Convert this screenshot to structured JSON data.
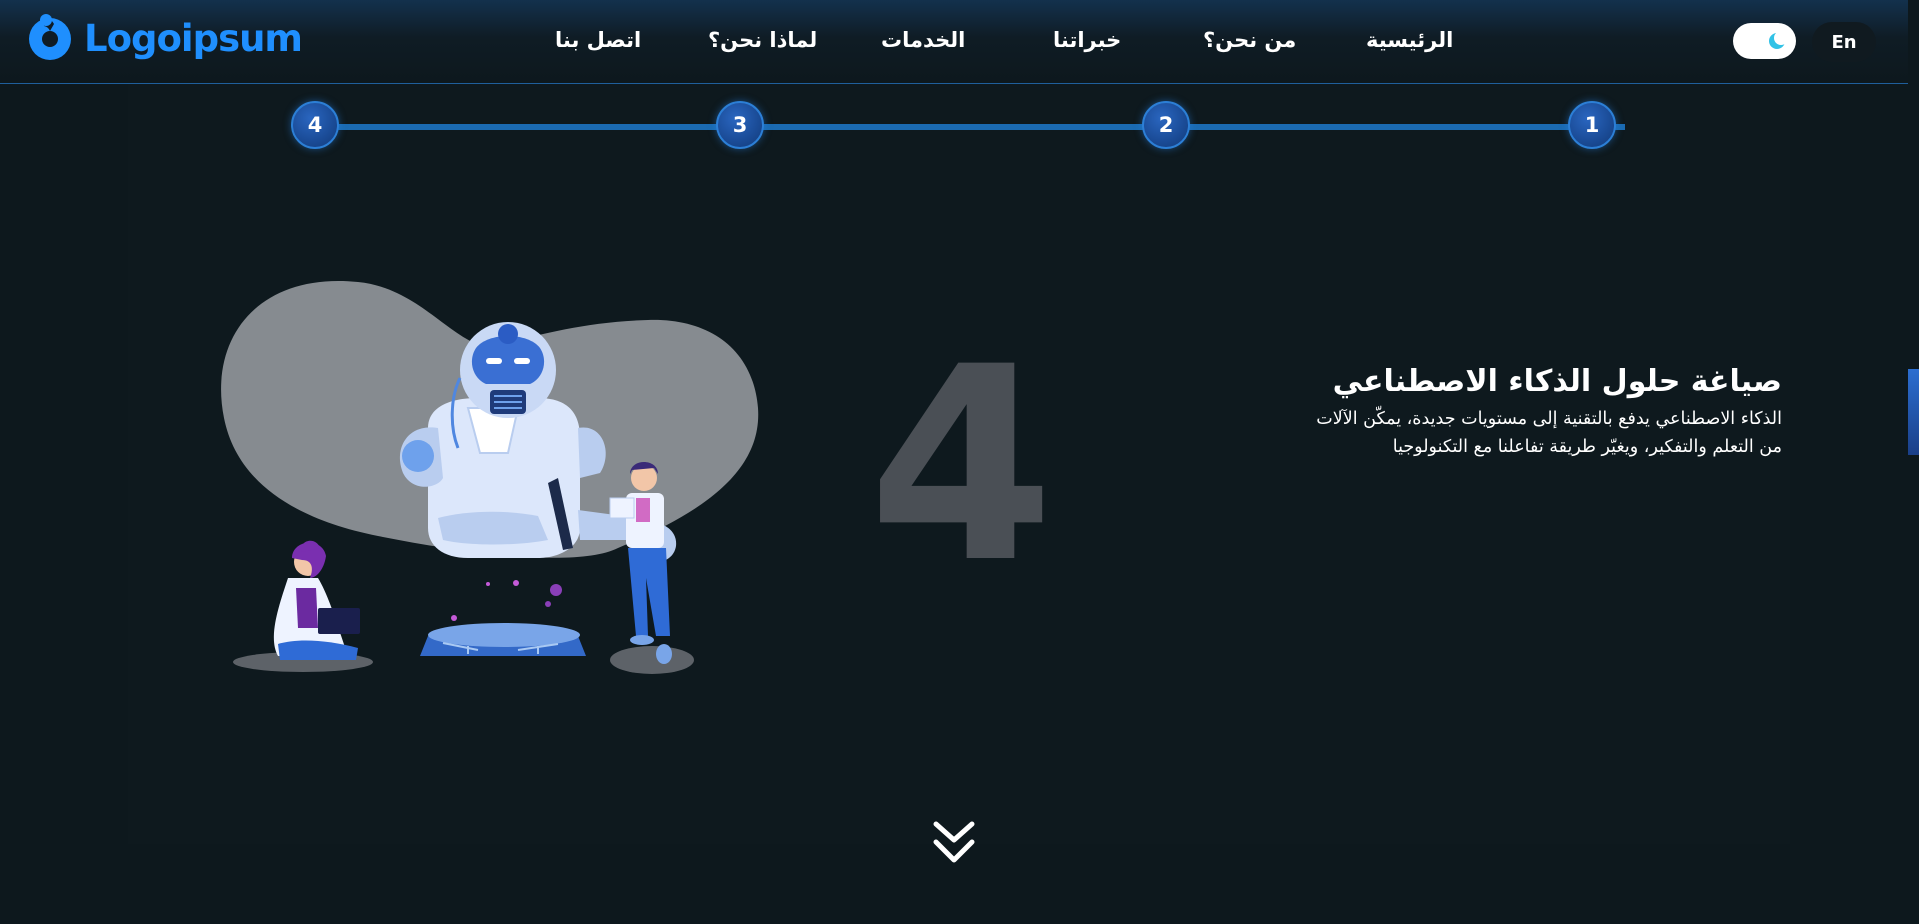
{
  "header": {
    "logo_text": "Logoipsum",
    "nav": [
      {
        "label": "الرئيسية"
      },
      {
        "label": "من نحن؟"
      },
      {
        "label": "خبراتنا"
      },
      {
        "label": "الخدمات"
      },
      {
        "label": "لماذا نحن؟"
      },
      {
        "label": "اتصل بنا"
      }
    ],
    "theme_toggle_icon": "moon-icon",
    "language_label": "En"
  },
  "stepper": {
    "steps": [
      "1",
      "2",
      "3",
      "4"
    ],
    "active_step": "4"
  },
  "slide": {
    "number": "4",
    "title": "صياغة حلول الذكاء الاصطناعي",
    "body_line1": "الذكاء الاصطناعي يدفع بالتقنية إلى مستويات جديدة، يمكّن الآلات",
    "body_line2": "من التعلم والتفكير، ويغيّر طريقة تفاعلنا مع التكنولوجيا",
    "illustration": "robot-and-scientists-illustration"
  },
  "scroll_icon": "double-chevron-down-icon",
  "colors": {
    "background": "#0d181d",
    "brand": "#1f8ffe",
    "step_line": "#1b6bb2",
    "step_circle": "#1a4b96",
    "big_number": "#4a4f55"
  }
}
